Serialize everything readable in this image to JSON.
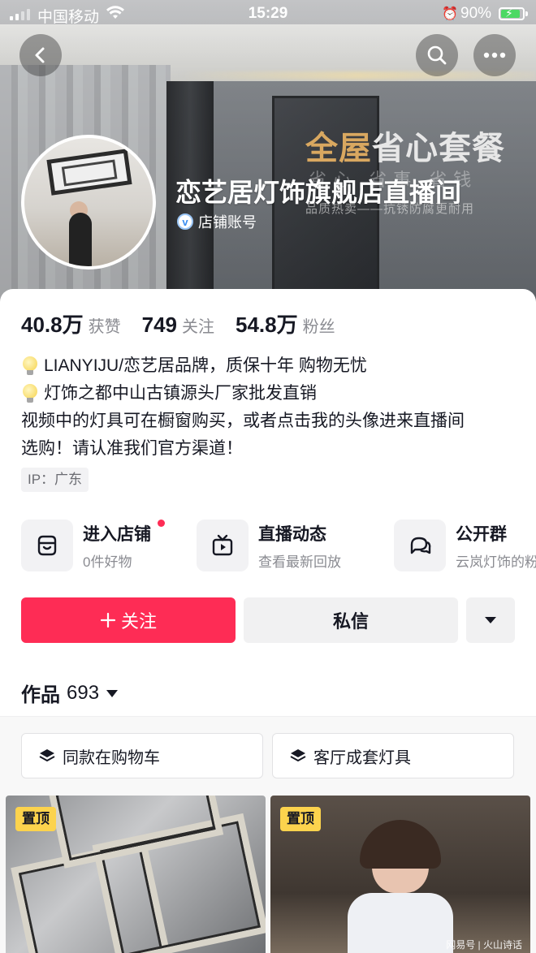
{
  "status_bar": {
    "carrier": "中国移动",
    "time": "15:29",
    "battery": "90%",
    "battery_level": 0.9
  },
  "colors": {
    "accent": "#fe2c55",
    "pin_tag": "#fcd34d",
    "promo_gold": "#d9a860",
    "verified_blue": "#3b8ef0"
  },
  "banner": {
    "promo_title_a": "全屋",
    "promo_title_b": "省心套餐",
    "promo_sub1": "省心 省事 省钱",
    "promo_sub2": "品质热卖——抗锈防腐更耐用"
  },
  "profile": {
    "name": "恋艺居灯饰旗舰店直播间",
    "badge_icon": "v",
    "verified_label": "店铺账号"
  },
  "stats": [
    {
      "value": "40.8万",
      "label": "获赞"
    },
    {
      "value": "749",
      "label": "关注"
    },
    {
      "value": "54.8万",
      "label": "粉丝"
    }
  ],
  "bio": {
    "line1": "LIANYIJU/恋艺居品牌，质保十年 购物无忧",
    "line2": " 灯饰之都中山古镇源头厂家批发直销",
    "line3": "视频中的灯具可在橱窗购买，或者点击我的头像进来直播间",
    "line4": "选购！请认准我们官方渠道！"
  },
  "ip_tag": "IP：广东",
  "entries": [
    {
      "title": "进入店铺",
      "sub": "0件好物",
      "icon": "shop-icon"
    },
    {
      "title": "直播动态",
      "sub": "查看最新回放",
      "icon": "tv-icon"
    },
    {
      "title": "公开群",
      "sub": "云岚灯饰的粉",
      "icon": "chat-icon"
    }
  ],
  "buttons": {
    "follow": "关注",
    "message": "私信"
  },
  "works": {
    "label": "作品",
    "count": "693"
  },
  "filters": [
    {
      "label": "同款在购物车"
    },
    {
      "label": "客厅成套灯具"
    }
  ],
  "videos": [
    {
      "pin": "置顶"
    },
    {
      "pin": "置顶",
      "watermark": "网易号 | 火山诗话"
    }
  ]
}
